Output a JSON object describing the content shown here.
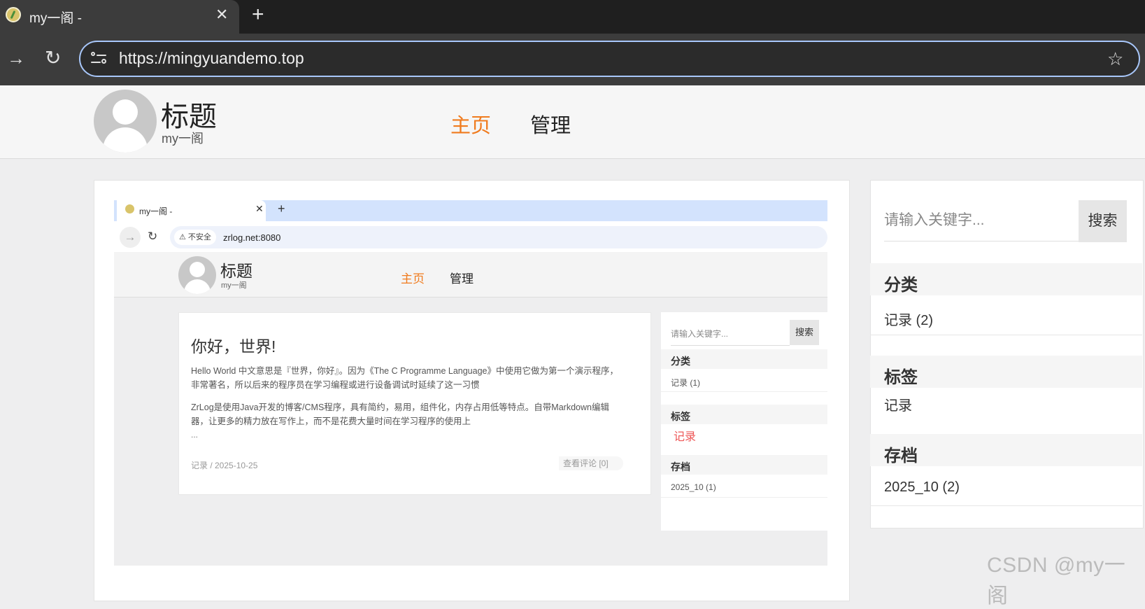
{
  "browser": {
    "tab_title": "my一阁 -",
    "tab_close": "✕",
    "new_tab": "+",
    "url": "https://mingyuandemo.top",
    "forward": "→",
    "reload": "↻",
    "bookmark": "☆"
  },
  "site": {
    "title": "标题",
    "subtitle": "my一阁",
    "nav": [
      {
        "label": "主页",
        "active": true
      },
      {
        "label": "管理",
        "active": false
      }
    ]
  },
  "embedded_screenshot": {
    "tab_title": "my一阁 -",
    "tab_close": "✕",
    "new_tab": "+",
    "insecure_label": "⚠ 不安全",
    "url": "zrlog.net:8080",
    "site_title": "标题",
    "site_subtitle": "my一阁",
    "nav": [
      "主页",
      "管理"
    ],
    "post": {
      "title": "你好，世界!",
      "paragraphs": [
        "Hello World 中文意思是『世界，你好』。因为《The C Programme Language》中使用它做为第一个演示程序，非常著名，所以后来的程序员在学习编程或进行设备调试时延续了这一习惯",
        "ZrLog是使用Java开发的博客/CMS程序，具有简约，易用，组件化，内存占用低等特点。自带Markdown编辑器，让更多的精力放在写作上，而不是花费大量时间在学习程序的使用上"
      ],
      "ellipsis": "...",
      "meta": "记录  /  2025-10-25",
      "comment_link": "查看评论 [0]"
    },
    "sidebar": {
      "search_placeholder": "请输入关键字...",
      "search_button": "搜索",
      "category_heading": "分类",
      "category_item": "记录 (1)",
      "tag_heading": "标签",
      "tag_item": "记录",
      "archive_heading": "存档",
      "archive_item": "2025_10 (1)"
    }
  },
  "sidebar": {
    "search_placeholder": "请输入关键字...",
    "search_button": "搜索",
    "category_heading": "分类",
    "category_item": "记录 (2)",
    "tag_heading": "标签",
    "tag_item": "记录",
    "archive_heading": "存档",
    "archive_item": "2025_10 (2)"
  },
  "watermark": "CSDN @my一阁",
  "colors": {
    "accent_orange": "#f07b1e",
    "focus_blue": "#a8c7fa",
    "tag_red": "#e55555"
  }
}
